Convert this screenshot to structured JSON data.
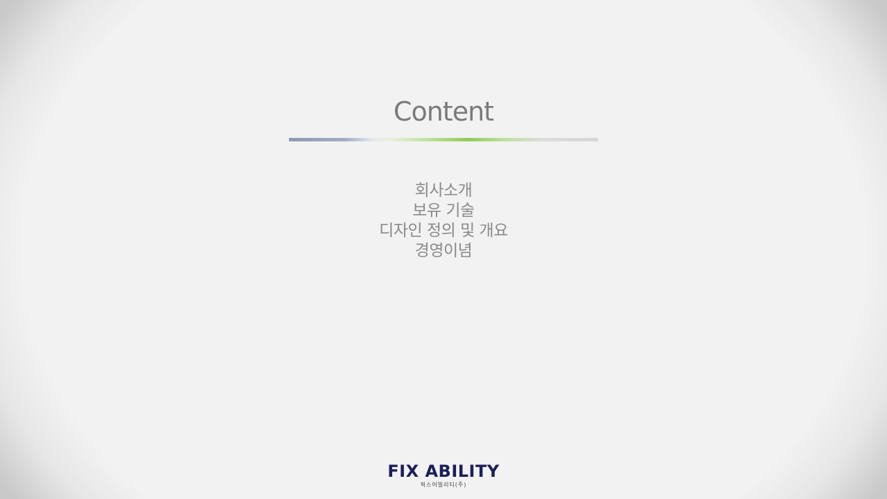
{
  "slide": {
    "title": "Content",
    "menu": [
      "회사소개",
      "보유 기술",
      "디자인 정의 및 개요",
      "경영이념"
    ],
    "logo": {
      "name": "FIX ABILITY",
      "subtitle": "픽스어빌리티(주)"
    },
    "colors": {
      "background": "#f2f2f2",
      "title_text": "#7a7a7a",
      "menu_text": "#8a8a8a",
      "divider_blue": "#8c98b6",
      "divider_green": "#8fcc56",
      "logo_navy": "#1b1e5a"
    }
  }
}
